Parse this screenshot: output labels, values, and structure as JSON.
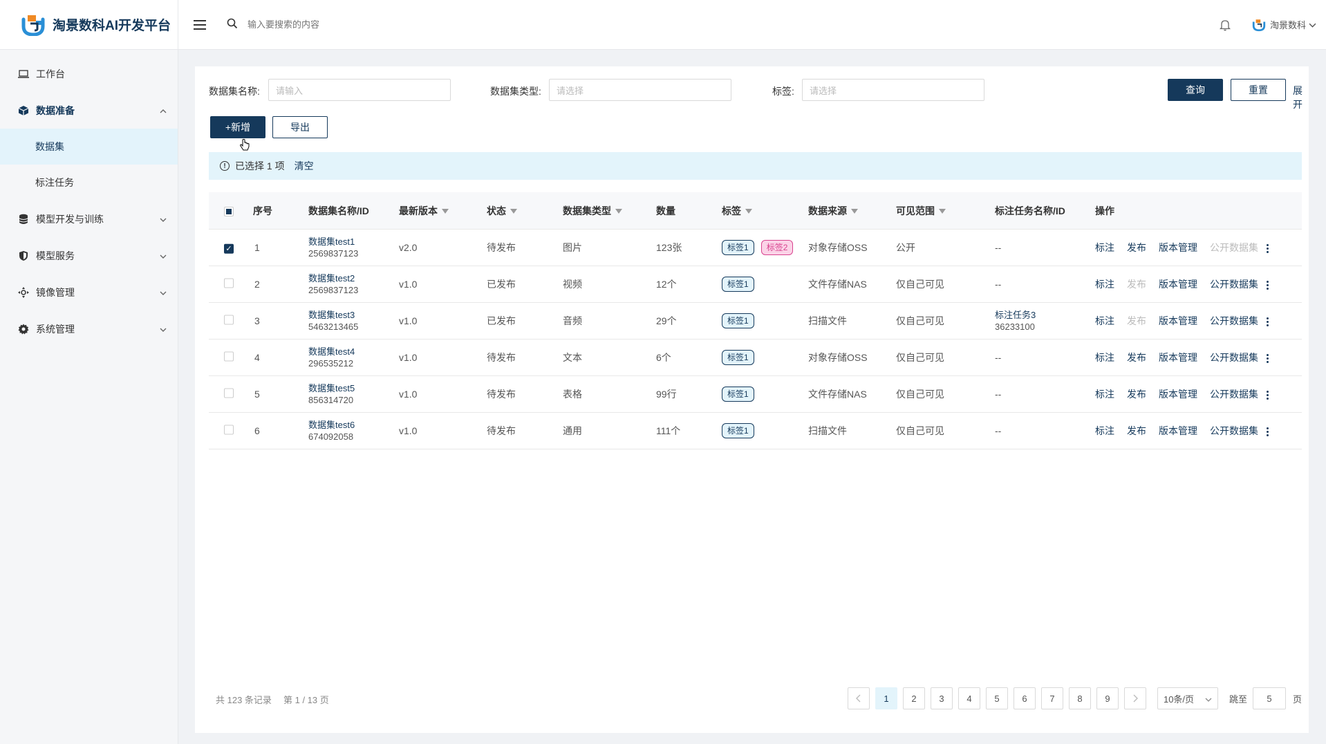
{
  "app": {
    "title": "淘景数科AI开发平台",
    "brand_color": "#15395b",
    "accent_color": "#2a8fd6"
  },
  "header": {
    "search_placeholder": "输入要搜索的内容",
    "user_name": "淘景数科"
  },
  "sidebar": {
    "items": [
      {
        "label": "工作台",
        "icon": "laptop-icon"
      },
      {
        "label": "数据准备",
        "icon": "cube-icon",
        "open": true,
        "children": [
          {
            "label": "数据集",
            "active": true
          },
          {
            "label": "标注任务"
          }
        ]
      },
      {
        "label": "模型开发与训练",
        "icon": "database-icon"
      },
      {
        "label": "模型服务",
        "icon": "shield-icon"
      },
      {
        "label": "镜像管理",
        "icon": "move-icon"
      },
      {
        "label": "系统管理",
        "icon": "gear-icon"
      }
    ]
  },
  "filters": {
    "name_label": "数据集名称:",
    "name_placeholder": "请输入",
    "type_label": "数据集类型:",
    "type_placeholder": "请选择",
    "tag_label": "标签:",
    "tag_placeholder": "请选择",
    "query": "查询",
    "reset": "重置",
    "expand": "展开"
  },
  "actions": {
    "add": "+新增",
    "export": "导出"
  },
  "alert": {
    "selected_text": "已选择 1 项",
    "clear": "清空"
  },
  "table": {
    "columns": [
      "序号",
      "数据集名称/ID",
      "最新版本",
      "状态",
      "数据集类型",
      "数量",
      "标签",
      "数据来源",
      "可见范围",
      "标注任务名称/ID",
      "操作"
    ],
    "rows": [
      {
        "checked": true,
        "index": "1",
        "name": "数据集test1",
        "id": "2569837123",
        "version": "v2.0",
        "status": "待发布",
        "type": "图片",
        "count": "123张",
        "tags": [
          "标签1",
          "标签2"
        ],
        "source": "对象存储OSS",
        "visibility": "公开",
        "task_name": "--",
        "task_id": "",
        "publish_enabled": true,
        "public_enabled": false
      },
      {
        "checked": false,
        "index": "2",
        "name": "数据集test2",
        "id": "2569837123",
        "version": "v1.0",
        "status": "已发布",
        "type": "视频",
        "count": "12个",
        "tags": [
          "标签1"
        ],
        "source": "文件存储NAS",
        "visibility": "仅自己可见",
        "task_name": "--",
        "task_id": "",
        "publish_enabled": false,
        "public_enabled": true
      },
      {
        "checked": false,
        "index": "3",
        "name": "数据集test3",
        "id": "5463213465",
        "version": "v1.0",
        "status": "已发布",
        "type": "音频",
        "count": "29个",
        "tags": [
          "标签1"
        ],
        "source": "扫描文件",
        "visibility": "仅自己可见",
        "task_name": "标注任务3",
        "task_id": "36233100",
        "publish_enabled": false,
        "public_enabled": true
      },
      {
        "checked": false,
        "index": "4",
        "name": "数据集test4",
        "id": "296535212",
        "version": "v1.0",
        "status": "待发布",
        "type": "文本",
        "count": "6个",
        "tags": [
          "标签1"
        ],
        "source": "对象存储OSS",
        "visibility": "仅自己可见",
        "task_name": "--",
        "task_id": "",
        "publish_enabled": true,
        "public_enabled": true
      },
      {
        "checked": false,
        "index": "5",
        "name": "数据集test5",
        "id": "856314720",
        "version": "v1.0",
        "status": "待发布",
        "type": "表格",
        "count": "99行",
        "tags": [
          "标签1"
        ],
        "source": "文件存储NAS",
        "visibility": "仅自己可见",
        "task_name": "--",
        "task_id": "",
        "publish_enabled": true,
        "public_enabled": true
      },
      {
        "checked": false,
        "index": "6",
        "name": "数据集test6",
        "id": "674092058",
        "version": "v1.0",
        "status": "待发布",
        "type": "通用",
        "count": "111个",
        "tags": [
          "标签1"
        ],
        "source": "扫描文件",
        "visibility": "仅自己可见",
        "task_name": "--",
        "task_id": "",
        "publish_enabled": true,
        "public_enabled": true
      }
    ],
    "ops": {
      "annotate": "标注",
      "publish": "发布",
      "version": "版本管理",
      "public": "公开数据集"
    }
  },
  "pagination": {
    "total": "共 123 条记录",
    "page_info": "第 1 / 13 页",
    "pages": [
      "1",
      "2",
      "3",
      "4",
      "5",
      "6",
      "7",
      "8",
      "9"
    ],
    "current": "1",
    "page_size": "10条/页",
    "jump_label": "跳至",
    "jump_value": "5",
    "page_unit": "页"
  }
}
